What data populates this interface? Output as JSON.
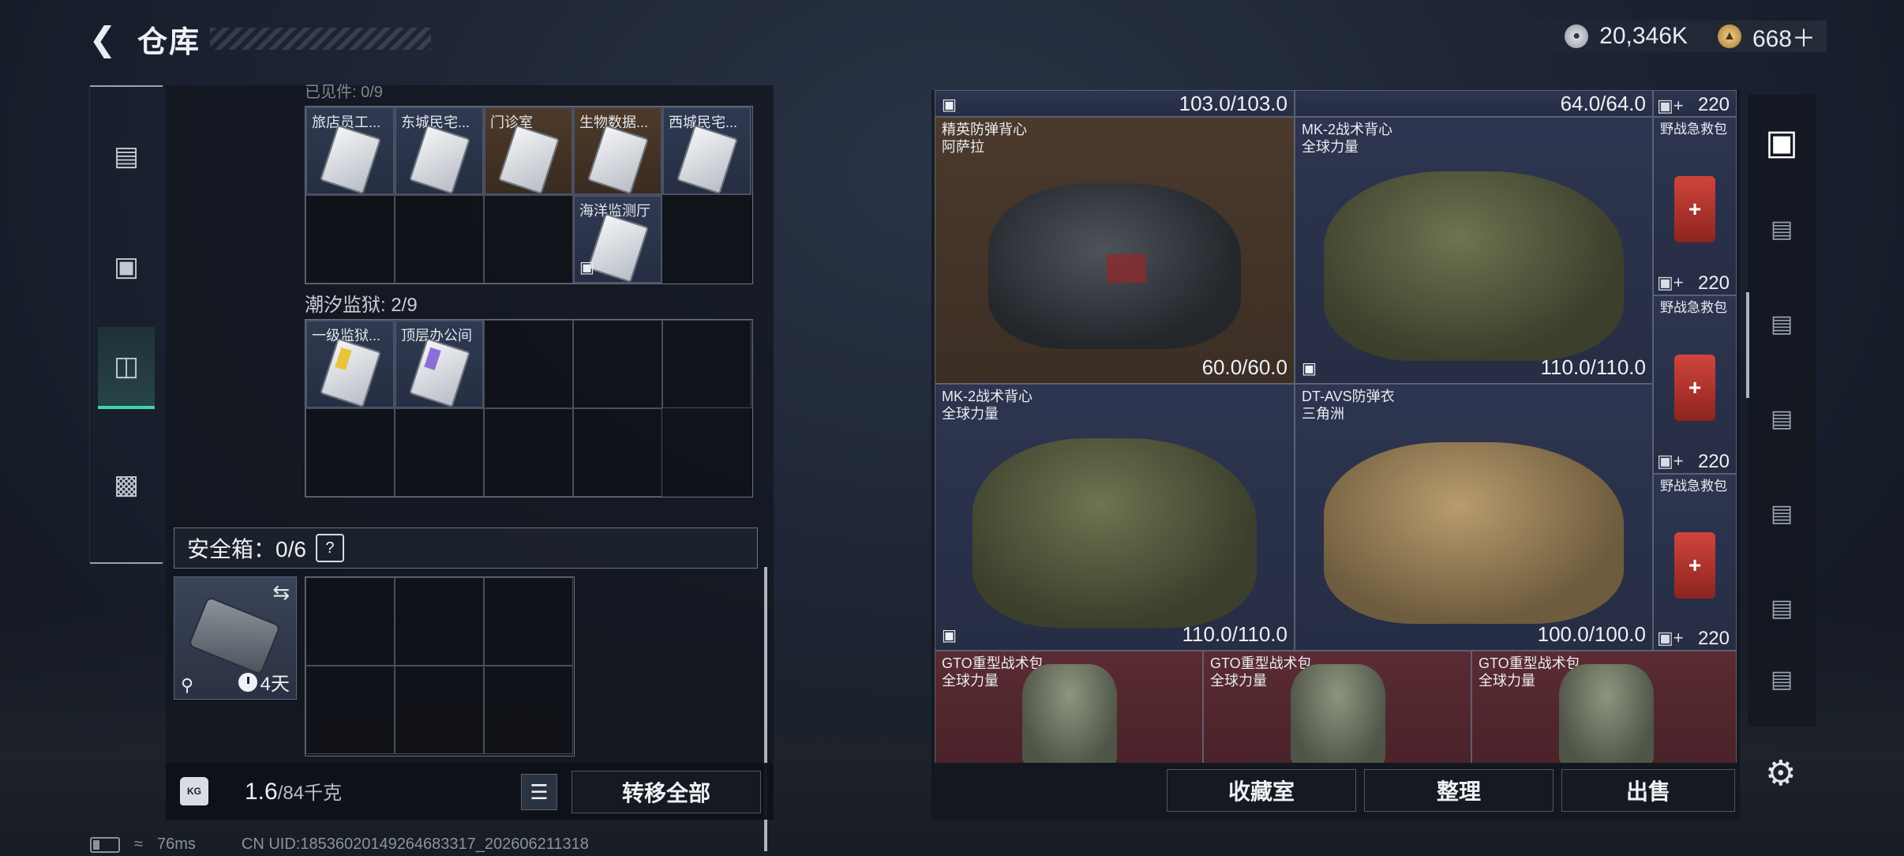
{
  "header": {
    "back_icon": "chevron-left-icon",
    "title": "仓库"
  },
  "currency": {
    "coin_amount": "20,346K",
    "gold_amount": "668＋"
  },
  "side_tabs": [
    {
      "icon": "pistol-icon"
    },
    {
      "icon": "armor-icon"
    },
    {
      "icon": "backpack-icon"
    },
    {
      "icon": "briefcase-icon"
    }
  ],
  "left": {
    "section1_label": "已见件: 0/9",
    "section1_cards": [
      "旅店员工...",
      "东城民宅...",
      "门诊室",
      "生物数据...",
      "西城民宅..."
    ],
    "section1_extra_card": "海洋监测厅",
    "section2_label": "潮汐监狱: 2/9",
    "section2_cards": [
      "一级监狱...",
      "顶层办公间"
    ],
    "safe_label": "安全箱：0/6",
    "help_glyph": "?",
    "safe_days": "4天",
    "weight_value": "1.6",
    "weight_cap": "/84千克",
    "transfer_all": "转移全部"
  },
  "right": {
    "header_cap1": "103.0/103.0",
    "header_cap2": "64.0/64.0",
    "header_cnt": "220",
    "items": [
      {
        "name": "精英防弹背心",
        "sub": "阿萨拉",
        "dur": "60.0/60.0"
      },
      {
        "name": "MK-2战术背心",
        "sub": "全球力量",
        "dur": "110.0/110.0"
      },
      {
        "name": "MK-2战术背心",
        "sub": "全球力量",
        "dur": "110.0/110.0"
      },
      {
        "name": "DT-AVS防弹衣",
        "sub": "三角洲",
        "dur": "100.0/100.0"
      },
      {
        "name": "GTO重型战术包",
        "sub": "全球力量"
      },
      {
        "name": "GTO重型战术包",
        "sub": "全球力量"
      },
      {
        "name": "GTO重型战术包",
        "sub": "全球力量"
      }
    ],
    "medkits": [
      {
        "name": "野战急救包",
        "cnt": "220"
      },
      {
        "name": "野战急救包",
        "cnt": "220"
      },
      {
        "name": "野战急救包",
        "cnt": "220"
      }
    ],
    "btn_collection": "收藏室",
    "btn_sort": "整理",
    "btn_sell": "出售"
  },
  "status": {
    "ping": "76ms",
    "uid": "CN UID:18536020149264683317_202606211318"
  }
}
